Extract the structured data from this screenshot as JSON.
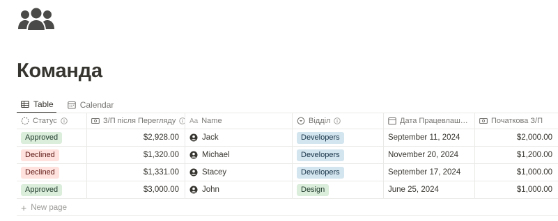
{
  "page": {
    "icon": "people-group-icon",
    "title": "Команда"
  },
  "tabs": [
    {
      "label": "Table",
      "icon": "table-icon",
      "active": true
    },
    {
      "label": "Calendar",
      "icon": "calendar-icon",
      "active": false
    }
  ],
  "columns": [
    {
      "label": "Статус",
      "icon": "status-icon"
    },
    {
      "label": "З/П після Перегляду",
      "icon": "number-icon"
    },
    {
      "label": "Name",
      "icon": "text-type-icon",
      "icon_text": "Aa"
    },
    {
      "label": "Відділ",
      "icon": "select-icon"
    },
    {
      "label": "Дата Працевлаш…",
      "icon": "calendar-icon"
    },
    {
      "label": "Початкова З/П",
      "icon": "number-icon"
    }
  ],
  "rows": [
    {
      "status": "Approved",
      "status_color": "green",
      "salary_after": "$2,928.00",
      "name": "Jack",
      "dept": "Developers",
      "dept_color": "blue",
      "hire_date": "September 11, 2024",
      "initial_salary": "$2,000.00"
    },
    {
      "status": "Declined",
      "status_color": "red",
      "salary_after": "$1,320.00",
      "name": "Michael",
      "dept": "Developers",
      "dept_color": "blue",
      "hire_date": "November 20, 2024",
      "initial_salary": "$1,200.00"
    },
    {
      "status": "Declined",
      "status_color": "red",
      "salary_after": "$1,331.00",
      "name": "Stacey",
      "dept": "Developers",
      "dept_color": "blue",
      "hire_date": "September 17, 2024",
      "initial_salary": "$1,000.00"
    },
    {
      "status": "Approved",
      "status_color": "green",
      "salary_after": "$3,000.00",
      "name": "John",
      "dept": "Design",
      "dept_color": "green",
      "hire_date": "June 25, 2024",
      "initial_salary": "$1,000.00"
    }
  ],
  "new_page_label": "New page",
  "colors": {
    "green_bg": "#dbeddb",
    "green_fg": "#1c3829",
    "red_bg": "#ffe2dd",
    "red_fg": "#5d1715",
    "blue_bg": "#d3e5ef",
    "blue_fg": "#183347",
    "text": "#37352f",
    "muted": "#787774",
    "border": "#e9e9e7"
  }
}
